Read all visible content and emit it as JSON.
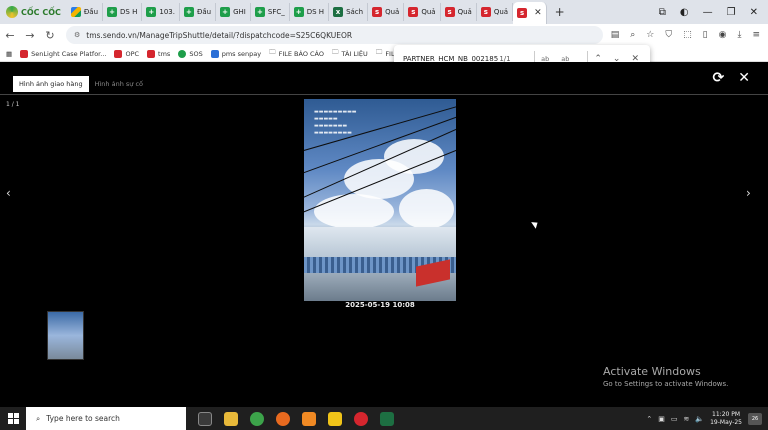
{
  "browser": {
    "brand": "CỐC CỐC",
    "tabs": [
      {
        "label": "Đầu",
        "icon": "drive-icon"
      },
      {
        "label": "DS H",
        "icon": "sheets-icon"
      },
      {
        "label": "103.",
        "icon": "sheets-icon"
      },
      {
        "label": "Đầu",
        "icon": "sheets-icon"
      },
      {
        "label": "GHI",
        "icon": "sheets-icon"
      },
      {
        "label": "SFC_",
        "icon": "sheets-icon"
      },
      {
        "label": "DS H",
        "icon": "sheets-icon"
      },
      {
        "label": "Sách",
        "icon": "excel-icon"
      },
      {
        "label": "Quả",
        "icon": "sendo-icon"
      },
      {
        "label": "Quả",
        "icon": "sendo-icon"
      },
      {
        "label": "Quả",
        "icon": "sendo-icon"
      },
      {
        "label": "Quả",
        "icon": "sendo-icon"
      }
    ],
    "url": "tms.sendo.vn/ManageTripShuttle/detail/?dispatchcode=S25C6QKUEOR",
    "bookmarks": [
      "SenLight Case Platfor...",
      "OPC",
      "tms",
      "SOS",
      "pms senpay",
      "FILE BÁO CÁO",
      "TÀI LIỆU",
      "FILE C"
    ]
  },
  "find": {
    "query": "PARTNER_HCM_NB_002185",
    "count": "1/1",
    "match_case": "ab",
    "whole_word": "ab"
  },
  "viewer": {
    "tab_delivery": "Hình ảnh giao hàng",
    "tab_incident": "Hình ảnh sự cố",
    "counter": "1 / 1",
    "photo_time": "2025-05-19 10:08"
  },
  "watermark": {
    "title": "Activate Windows",
    "subtitle": "Go to Settings to activate Windows."
  },
  "taskbar": {
    "search_placeholder": "Type here to search",
    "time": "11:20 PM",
    "date": "19-May-25",
    "notifications": "26"
  },
  "colors": {
    "sheets": "#1e9e4a",
    "sendo": "#d5262e",
    "excel": "#1d6f42"
  }
}
